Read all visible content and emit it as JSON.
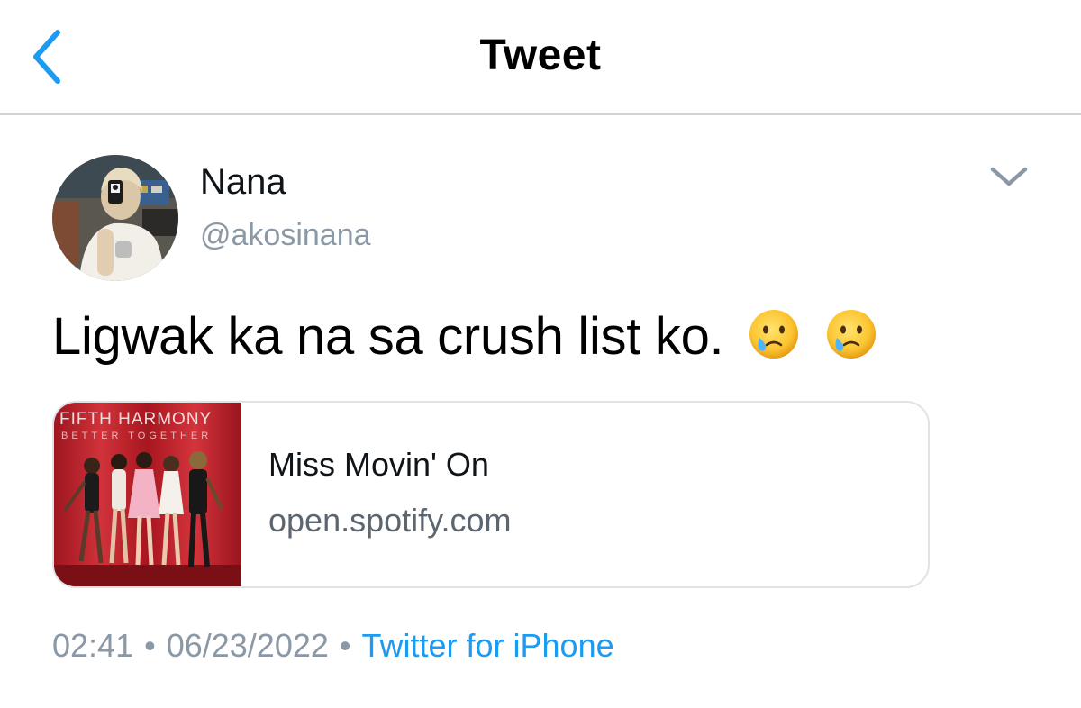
{
  "header": {
    "title": "Tweet",
    "back_icon": "chevron-left-icon",
    "accent_color": "#1d9bf0"
  },
  "author": {
    "display_name": "Nana",
    "handle": "@akosinana"
  },
  "tweet": {
    "text": "Ligwak ka na sa crush list ko.",
    "emojis": [
      "face-holding-back-tears-emoji",
      "face-holding-back-tears-emoji"
    ]
  },
  "card": {
    "thumbnail_line1": "FIFTH HARMONY",
    "thumbnail_line2": "BETTER TOGETHER",
    "title": "Miss Movin' On",
    "domain": "open.spotify.com"
  },
  "meta": {
    "time": "02:41",
    "separator": "•",
    "date": "06/23/2022",
    "source": "Twitter for iPhone"
  }
}
